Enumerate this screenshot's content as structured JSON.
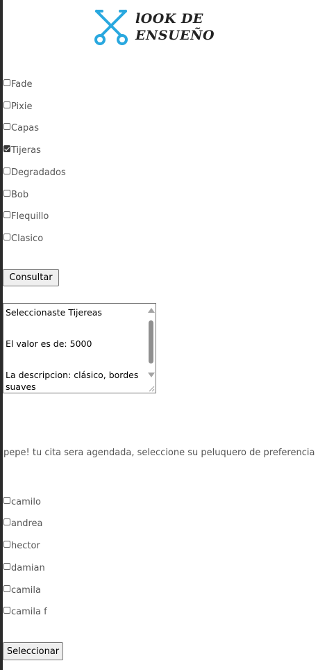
{
  "logo": {
    "line1": "lOOK DE",
    "line2": "ENSUEÑO",
    "icon": "scissors-icon",
    "icon_color": "#29a8df"
  },
  "styles": [
    {
      "label": "Fade",
      "checked": false
    },
    {
      "label": "Pixie",
      "checked": false
    },
    {
      "label": "Capas",
      "checked": false
    },
    {
      "label": "Tijeras",
      "checked": true
    },
    {
      "label": "Degradados",
      "checked": false
    },
    {
      "label": "Bob",
      "checked": false
    },
    {
      "label": "Flequillo",
      "checked": false
    },
    {
      "label": "Clasico",
      "checked": false
    }
  ],
  "consult_button": "Consultar",
  "result": {
    "line1": "Seleccionaste Tijereas",
    "line2": "El valor es de: 5000",
    "line3": "La descripcion: clásico, bordes suaves"
  },
  "message": "pepe! tu cita sera agendada, seleccione su peluquero de preferencia",
  "barbers": [
    {
      "label": "camilo",
      "checked": false
    },
    {
      "label": "andrea",
      "checked": false
    },
    {
      "label": "hector",
      "checked": false
    },
    {
      "label": "damian",
      "checked": false
    },
    {
      "label": "camila",
      "checked": false
    },
    {
      "label": "camila f",
      "checked": false
    }
  ],
  "select_button": "Seleccionar"
}
